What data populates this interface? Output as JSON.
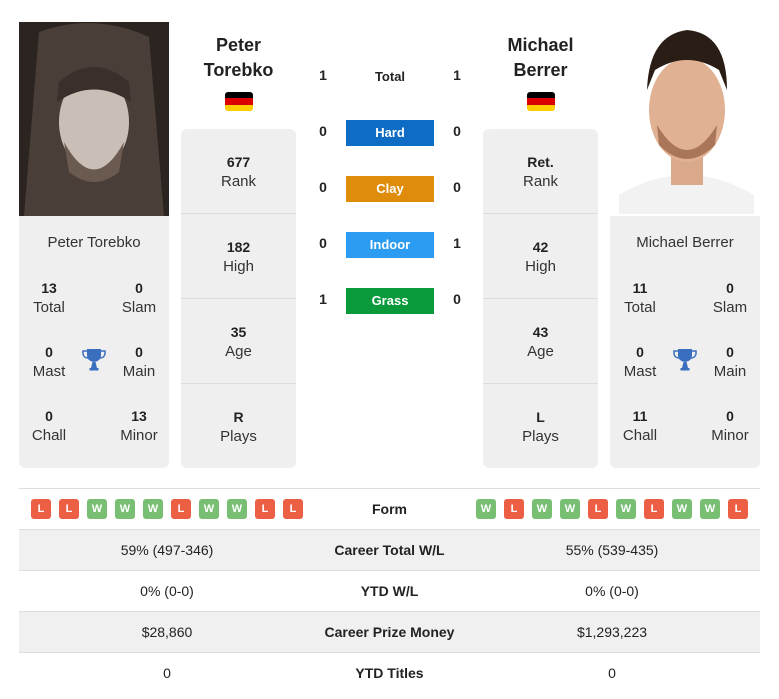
{
  "players": {
    "left": {
      "name_line1": "Peter",
      "name_line2": "Torebko",
      "full_name": "Peter Torebko",
      "country": "Germany",
      "titles": {
        "total": "13",
        "total_label": "Total",
        "slam": "0",
        "slam_label": "Slam",
        "mast": "0",
        "mast_label": "Mast",
        "main": "0",
        "main_label": "Main",
        "chall": "0",
        "chall_label": "Chall",
        "minor": "13",
        "minor_label": "Minor"
      },
      "rank": {
        "value": "677",
        "label": "Rank"
      },
      "high": {
        "value": "182",
        "label": "High"
      },
      "age": {
        "value": "35",
        "label": "Age"
      },
      "plays": {
        "value": "R",
        "label": "Plays"
      },
      "form": [
        "L",
        "L",
        "W",
        "W",
        "W",
        "L",
        "W",
        "W",
        "L",
        "L"
      ]
    },
    "right": {
      "name_line1": "Michael",
      "name_line2": "Berrer",
      "full_name": "Michael Berrer",
      "country": "Germany",
      "titles": {
        "total": "11",
        "total_label": "Total",
        "slam": "0",
        "slam_label": "Slam",
        "mast": "0",
        "mast_label": "Mast",
        "main": "0",
        "main_label": "Main",
        "chall": "11",
        "chall_label": "Chall",
        "minor": "0",
        "minor_label": "Minor"
      },
      "rank": {
        "value": "Ret.",
        "label": "Rank"
      },
      "high": {
        "value": "42",
        "label": "High"
      },
      "age": {
        "value": "43",
        "label": "Age"
      },
      "plays": {
        "value": "L",
        "label": "Plays"
      },
      "form": [
        "W",
        "L",
        "W",
        "W",
        "L",
        "W",
        "L",
        "W",
        "W",
        "L"
      ]
    }
  },
  "h2h": {
    "total": {
      "label": "Total",
      "left": "1",
      "right": "1"
    },
    "surfaces": [
      {
        "label": "Hard",
        "left": "0",
        "right": "0",
        "color": "#0f6cc4"
      },
      {
        "label": "Clay",
        "left": "0",
        "right": "0",
        "color": "#e08c0b"
      },
      {
        "label": "Indoor",
        "left": "0",
        "right": "1",
        "color": "#2c9cf2"
      },
      {
        "label": "Grass",
        "left": "1",
        "right": "0",
        "color": "#0b9a3b"
      }
    ]
  },
  "comparison": {
    "form_label": "Form",
    "rows": [
      {
        "label": "Career Total W/L",
        "left": "59% (497-346)",
        "right": "55% (539-435)"
      },
      {
        "label": "YTD W/L",
        "left": "0% (0-0)",
        "right": "0% (0-0)"
      },
      {
        "label": "Career Prize Money",
        "left": "$28,860",
        "right": "$1,293,223"
      },
      {
        "label": "YTD Titles",
        "left": "0",
        "right": "0"
      }
    ]
  },
  "colors": {
    "win": "#78bf73",
    "loss": "#ec5f44",
    "trophy": "#3a6fc0",
    "flag": [
      "#000000",
      "#dd0000",
      "#ffce00"
    ]
  }
}
